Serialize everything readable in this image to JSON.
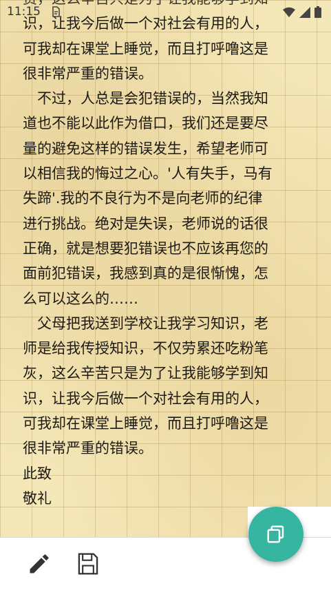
{
  "status_bar": {
    "time": "11:15"
  },
  "letter": {
    "lines": [
      "费，这么辛苦只是为了让我能够学到知",
      "识，让我今后做一个对社会有用的人，",
      "可我却在课堂上睡觉，而且打呼噜这是",
      "很非常严重的错误。",
      "　不过，人总是会犯错误的，当然我知",
      "道也不能以此作为借口，我们还是要尽",
      "量的避免这样的错误发生，希望老师可",
      "以相信我的悔过之心。'人有失手，马有",
      "失蹄'.我的不良行为不是向老师的纪律",
      "进行挑战。绝对是失误，老师说的话很",
      "正确，就是想要犯错误也不应该再您的",
      "面前犯错误，我感到真的是很惭愧，怎",
      "么可以这么的……",
      "　父母把我送到学校让我学习知识，老",
      "师是给我传授知识，不仅劳累还吃粉笔",
      "灰，这么辛苦只是为了让我能够学到知",
      "识，让我今后做一个对社会有用的人，",
      "可我却在课堂上睡觉，而且打呼噜这是",
      "很非常严重的错误。",
      "此致",
      " 敬礼"
    ]
  },
  "toolbar": {
    "edit_icon": "pencil-icon",
    "save_icon": "floppy-disk-icon",
    "fab_icon": "copy-icon"
  },
  "colors": {
    "accent": "#36b5a0",
    "paper": "#f4e7b8",
    "text": "#1d1a14"
  }
}
